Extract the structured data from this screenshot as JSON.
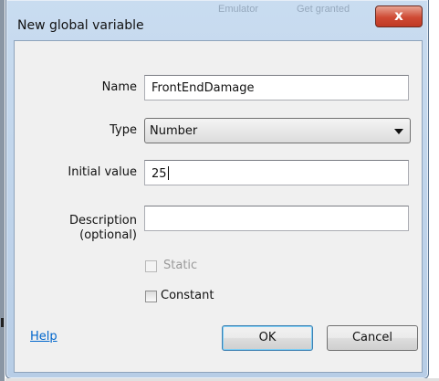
{
  "dialog": {
    "title": "New global variable",
    "close_glyph": "x",
    "background_hint_1": "Emulator",
    "background_hint_2": "Get granted"
  },
  "form": {
    "name_label": "Name",
    "name_value": "FrontEndDamage",
    "type_label": "Type",
    "type_value": "Number",
    "initial_label": "Initial value",
    "initial_value": "25",
    "description_label_1": "Description",
    "description_label_2": "(optional)",
    "description_value": "",
    "static_label": "Static",
    "static_checked": false,
    "static_enabled": false,
    "constant_label": "Constant",
    "constant_checked": false
  },
  "footer": {
    "help_label": "Help",
    "ok_label": "OK",
    "cancel_label": "Cancel"
  },
  "colors": {
    "title_bar": "#c9dcf0",
    "close_button": "#cf4a34",
    "link": "#0066cc",
    "client_bg": "#f0f0f0"
  }
}
